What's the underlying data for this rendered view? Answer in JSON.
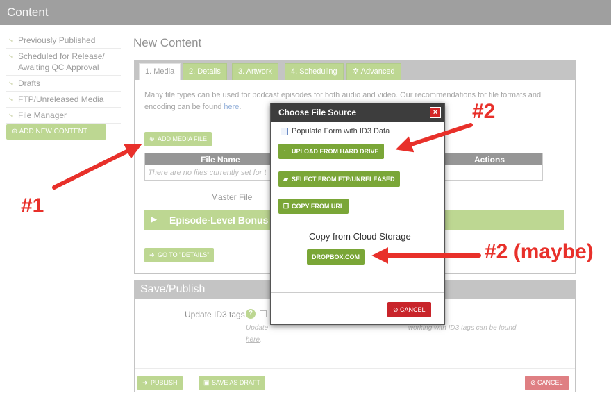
{
  "topbar": {
    "title": "Content"
  },
  "sidebar": {
    "items": [
      {
        "label": "Previously Published"
      },
      {
        "label": "Scheduled for Release/ Awaiting QC Approval"
      },
      {
        "label": "Drafts"
      },
      {
        "label": "FTP/Unreleased Media"
      },
      {
        "label": "File Manager"
      }
    ],
    "add_button": "ADD NEW CONTENT"
  },
  "main": {
    "title": "New Content",
    "tabs": [
      {
        "label": "1. Media"
      },
      {
        "label": "2. Details"
      },
      {
        "label": "3. Artwork"
      },
      {
        "label": "4. Scheduling"
      },
      {
        "label": "Advanced"
      }
    ],
    "intro_text": "Many file types can be used for podcast episodes for both audio and video. Our recommendations for file formats and encoding can be found",
    "intro_link": "here",
    "add_media_button": "ADD MEDIA FILE",
    "file_table": {
      "col_name": "File Name",
      "col_actions": "Actions",
      "empty": "There are no files currently set for t"
    },
    "master_file_label": "Master File",
    "bonus_section": "Episode-Level Bonus C",
    "goto_details_button": "GO TO \"DETAILS\""
  },
  "save_publish": {
    "title": "Save/Publish",
    "id3_label": "Update ID3 tags",
    "help_icon": "?",
    "note_visible": "Update",
    "note_middle": "working with ID3 tags can be found",
    "note_link": "here",
    "publish_button": "PUBLISH",
    "save_draft_button": "SAVE AS DRAFT",
    "cancel_button": "CANCEL"
  },
  "modal": {
    "title": "Choose File Source",
    "close_symbol": "×",
    "id3_checkbox_label": "Populate Form with ID3 Data",
    "upload_button": "UPLOAD FROM HARD DRIVE",
    "ftp_button": "SELECT FROM FTP/UNRELEASED",
    "url_button": "COPY FROM URL",
    "cloud_legend": "Copy from Cloud Storage",
    "dropbox_button": "DROPBOX.COM",
    "cancel_button": "CANCEL"
  },
  "annotations": {
    "one": "#1",
    "two": "#2",
    "two_maybe": "#2 (maybe)"
  },
  "colors": {
    "accent_green": "#8dbb44",
    "danger_red": "#c8242a",
    "arrow_red": "#e8302a",
    "header_gray": "#5a5a5a"
  }
}
